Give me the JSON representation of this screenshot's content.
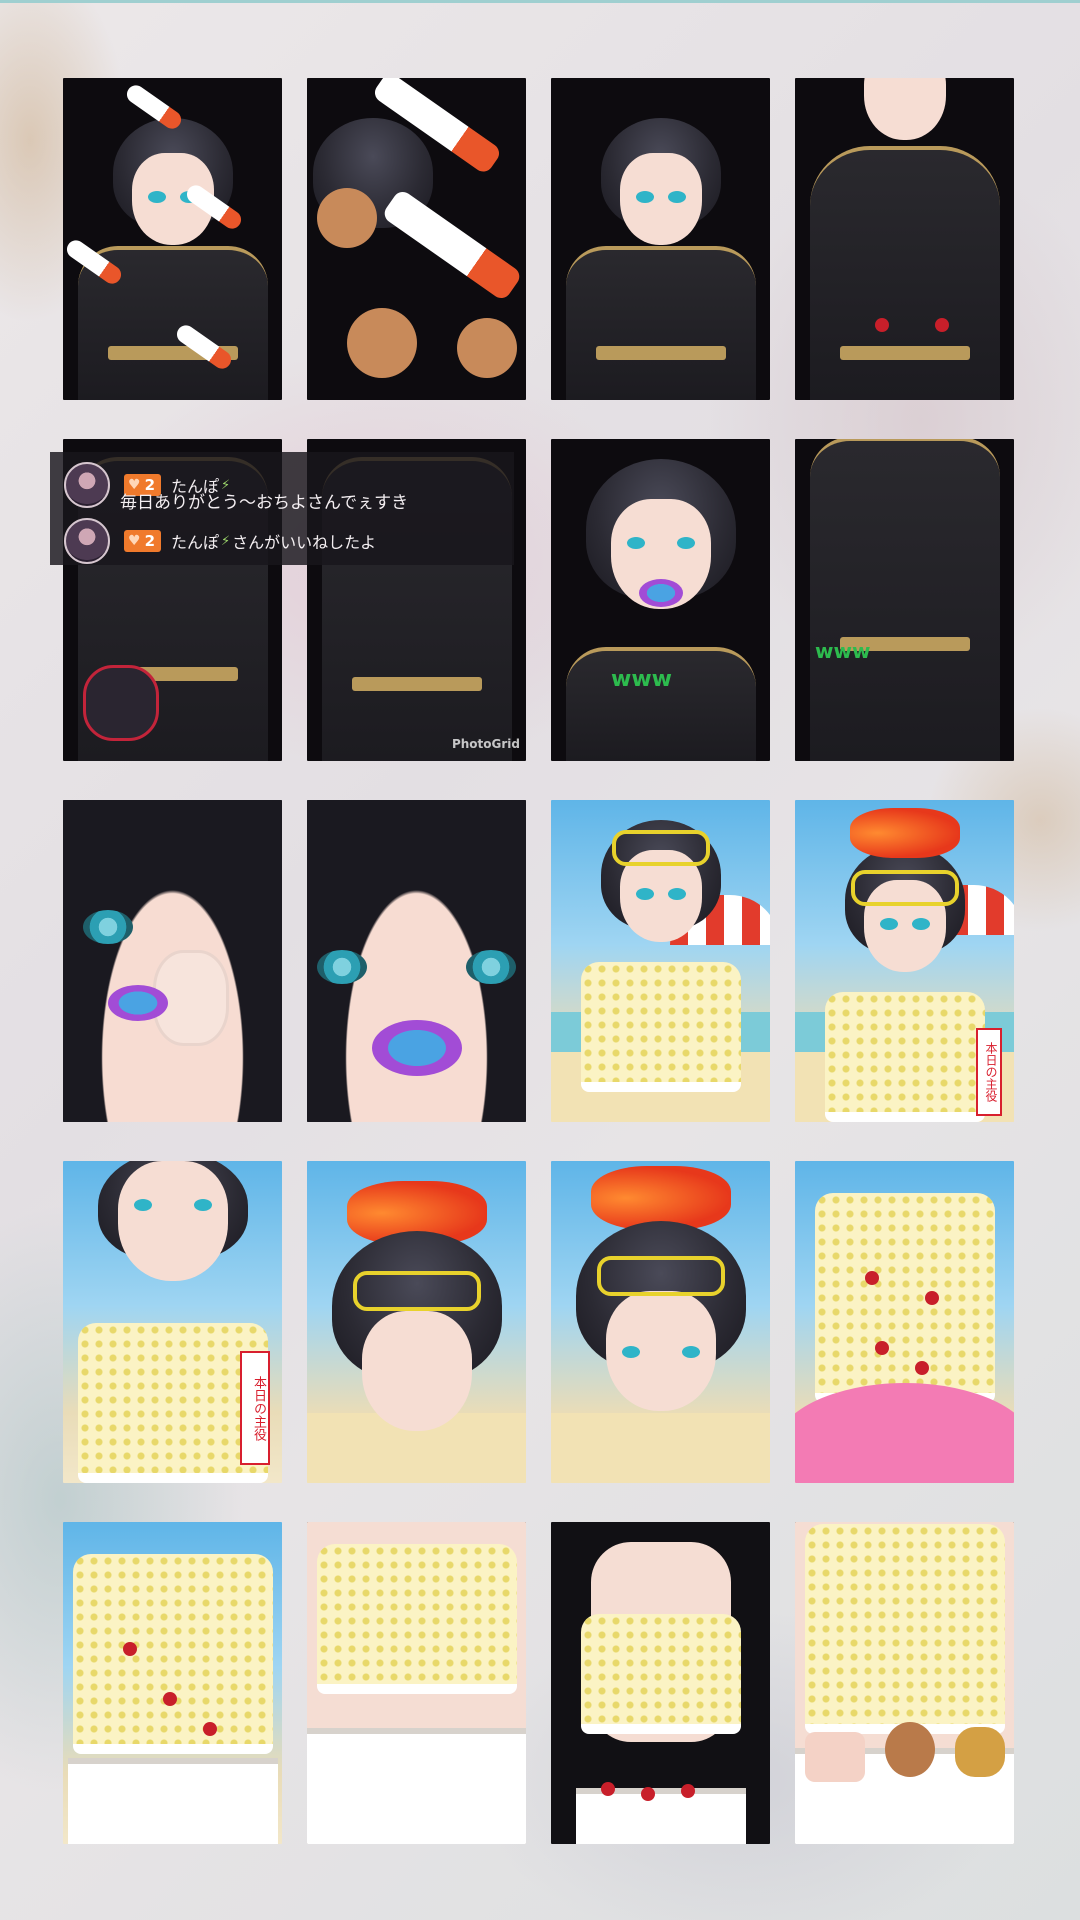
{
  "chat": {
    "first": {
      "badge_count": "2",
      "username": "たんぽ",
      "message": "毎日ありがとう～おちよさんでぇすき"
    },
    "second": {
      "badge_count": "2",
      "username": "たんぽ",
      "system_text": "さんがいいねしたよ"
    }
  },
  "watermark": "PhotoGrid",
  "overlay_text": {
    "sticker_www": "www",
    "ribbon_label": "本日の主役"
  },
  "colors": {
    "badge": "#f07a2c",
    "accent_gold": "#b99a5b",
    "eye": "#2fb4c8"
  },
  "icons": [
    "heart-icon",
    "leaf-icon",
    "avatar"
  ]
}
